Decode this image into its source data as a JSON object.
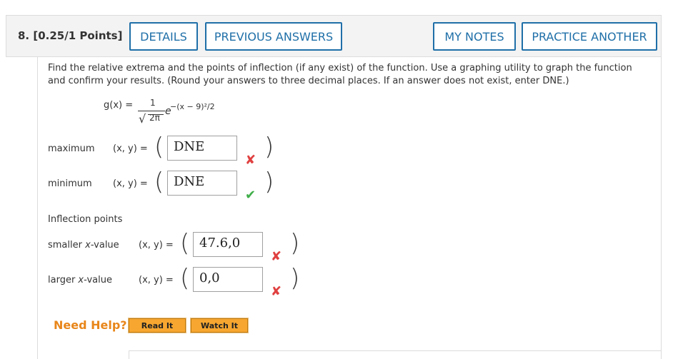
{
  "question": {
    "number_label": "8.",
    "points": "[0.25/1 Points]"
  },
  "buttons": {
    "details": "DETAILS",
    "previous_answers": "PREVIOUS ANSWERS",
    "my_notes": "MY NOTES",
    "practice_another": "PRACTICE ANOTHER"
  },
  "instructions": "Find the relative extrema and the points of inflection (if any exist) of the function. Use a graphing utility to graph the function and confirm your results. (Round your answers to three decimal places. If an answer does not exist, enter DNE.)",
  "formula": {
    "lhs": "g(x) =",
    "numerator": "1",
    "denominator": "2π",
    "base": "e",
    "exponent": "−(x − 9)²/2"
  },
  "answers": {
    "maximum": {
      "label": "maximum",
      "xy": "(x, y) =",
      "value": "DNE",
      "status": "incorrect"
    },
    "minimum": {
      "label": "minimum",
      "xy": "(x, y) =",
      "value": "DNE",
      "status": "correct"
    },
    "inflection_heading": "Inflection points",
    "smaller": {
      "label_prefix": "smaller ",
      "label_var": "x",
      "label_suffix": "-value",
      "xy": "(x, y) =",
      "value": "47.6,0",
      "status": "incorrect"
    },
    "larger": {
      "label_prefix": "larger ",
      "label_var": "x",
      "label_suffix": "-value",
      "xy": "(x, y) =",
      "value": "0,0",
      "status": "incorrect"
    }
  },
  "marks": {
    "incorrect": "✘",
    "correct": "✔"
  },
  "colors": {
    "accent": "#1f6fa8",
    "help": "#e8861a",
    "incorrect": "#e04040",
    "correct": "#3fae49"
  },
  "help": {
    "label": "Need Help?",
    "read_it": "Read It",
    "watch_it": "Watch It"
  }
}
